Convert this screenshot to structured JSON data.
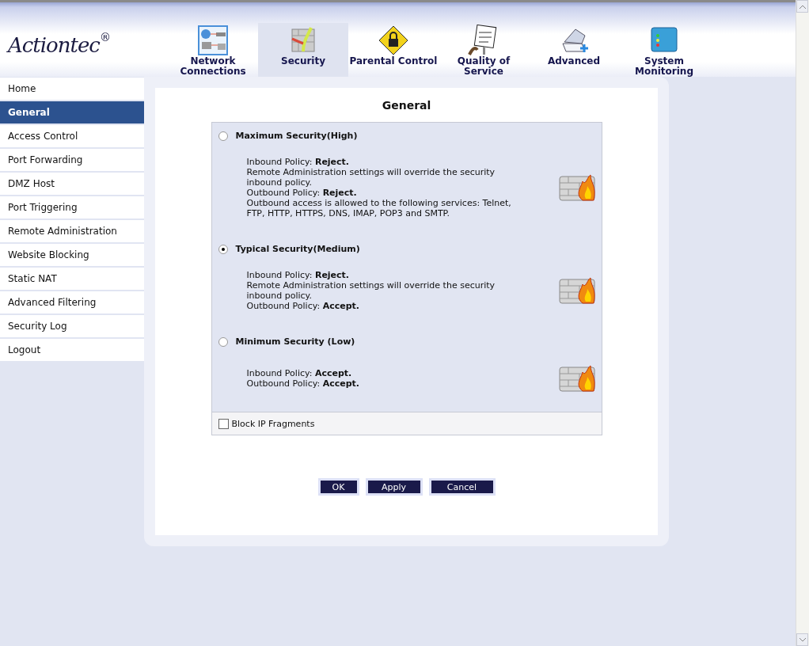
{
  "logo": {
    "text": "Actiontec",
    "mark": "®"
  },
  "nav": [
    {
      "label": "Network Connections",
      "kind": "network",
      "selected": false
    },
    {
      "label": "Security",
      "kind": "security",
      "selected": true
    },
    {
      "label": "Parental Control",
      "kind": "lock",
      "selected": false
    },
    {
      "label": "Quality of Service",
      "kind": "sign",
      "selected": false
    },
    {
      "label": "Advanced",
      "kind": "scanner",
      "selected": false
    },
    {
      "label": "System Monitoring",
      "kind": "monitor",
      "selected": false
    }
  ],
  "sidebar": {
    "items": [
      {
        "label": "Home",
        "selected": false
      },
      {
        "label": "General",
        "selected": true
      },
      {
        "label": "Access Control",
        "selected": false
      },
      {
        "label": "Port Forwarding",
        "selected": false
      },
      {
        "label": "DMZ Host",
        "selected": false
      },
      {
        "label": "Port Triggering",
        "selected": false
      },
      {
        "label": "Remote Administration",
        "selected": false
      },
      {
        "label": "Website Blocking",
        "selected": false
      },
      {
        "label": "Static NAT",
        "selected": false
      },
      {
        "label": "Advanced Filtering",
        "selected": false
      },
      {
        "label": "Security Log",
        "selected": false
      },
      {
        "label": "Logout",
        "selected": false
      }
    ]
  },
  "page": {
    "title": "General",
    "options": [
      {
        "label": "Maximum Security(High)",
        "selected": false,
        "lines": [
          "Inbound Policy: **Reject.**",
          "Remote Administration settings will override the security inbound policy.",
          "Outbound Policy: **Reject.**",
          "Outbound access is allowed to the following services: Telnet, FTP, HTTP, HTTPS, DNS, IMAP, POP3 and SMTP."
        ]
      },
      {
        "label": "Typical Security(Medium)",
        "selected": true,
        "lines": [
          "Inbound Policy: **Reject.**",
          "Remote Administration settings will override the security inbound policy.",
          "Outbound Policy: **Accept.**"
        ]
      },
      {
        "label": "Minimum Security (Low)",
        "selected": false,
        "lines": [
          "Inbound Policy: **Accept.**",
          "Outbound Policy: **Accept.**"
        ]
      }
    ],
    "block_ip_fragments": {
      "label": "Block IP Fragments",
      "checked": false
    },
    "buttons": [
      "OK",
      "Apply",
      "Cancel"
    ]
  }
}
